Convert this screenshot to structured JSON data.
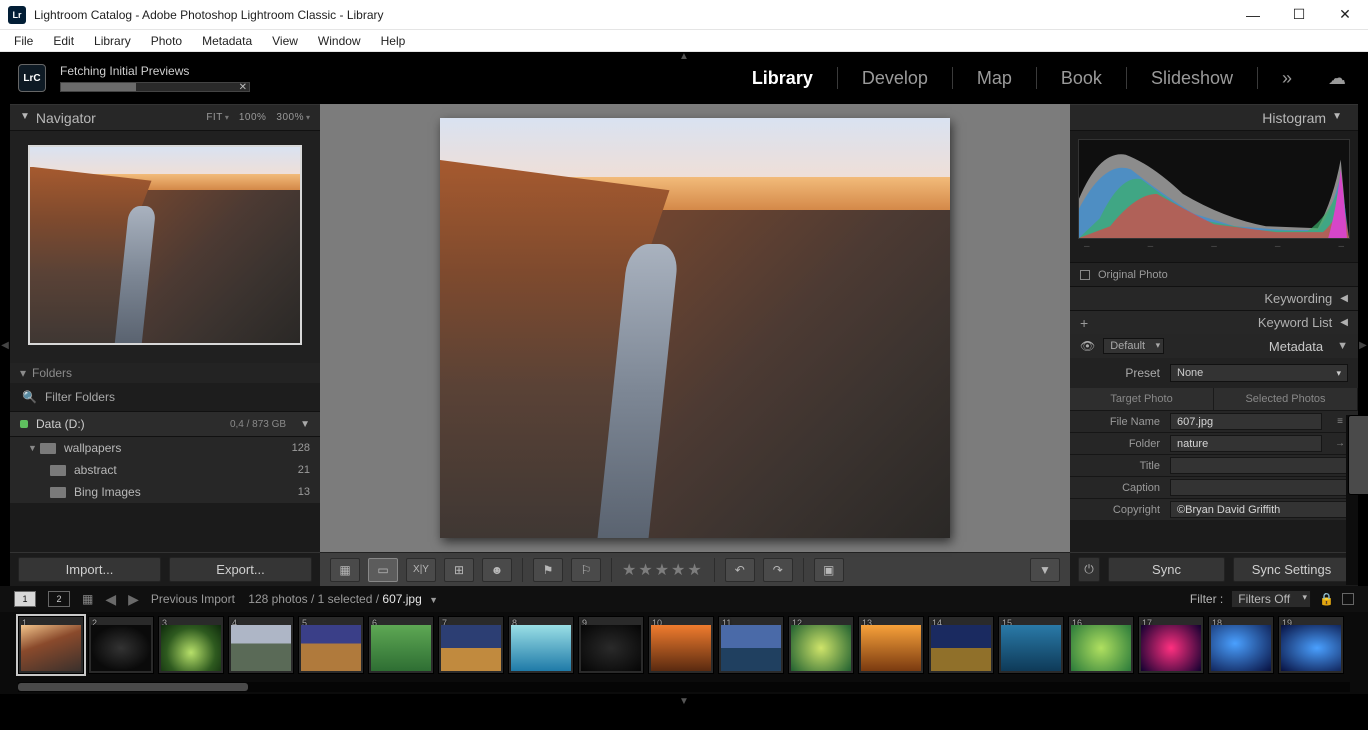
{
  "window": {
    "title": "Lightroom Catalog - Adobe Photoshop Lightroom Classic - Library",
    "app_badge": "Lr"
  },
  "menu": {
    "items": [
      "File",
      "Edit",
      "Library",
      "Photo",
      "Metadata",
      "View",
      "Window",
      "Help"
    ]
  },
  "topstrip": {
    "badge": "LrC",
    "status": "Fetching Initial Previews",
    "modules": [
      "Library",
      "Develop",
      "Map",
      "Book",
      "Slideshow"
    ],
    "active_module": "Library",
    "more_glyph": "»"
  },
  "navigator": {
    "title": "Navigator",
    "zoom_levels": [
      "FIT",
      "100%",
      "300%"
    ]
  },
  "folders": {
    "title": "Folders",
    "filter_placeholder": "Filter Folders",
    "drive": {
      "name": "Data (D:)",
      "size": "0,4 / 873 GB"
    },
    "tree": [
      {
        "name": "wallpapers",
        "count": 128,
        "expanded": true
      },
      {
        "name": "abstract",
        "count": 21,
        "child": true
      },
      {
        "name": "Bing Images",
        "count": 13,
        "child": true
      }
    ],
    "import_label": "Import...",
    "export_label": "Export..."
  },
  "right": {
    "histogram_title": "Histogram",
    "original_photo": "Original Photo",
    "keywording": "Keywording",
    "keyword_list": "Keyword List",
    "metadata_title": "Metadata",
    "metadata_default": "Default",
    "preset_label": "Preset",
    "preset_value": "None",
    "tabs": [
      "Target Photo",
      "Selected Photos"
    ],
    "rows": [
      {
        "label": "File Name",
        "value": "607.jpg",
        "icon": "≡"
      },
      {
        "label": "Folder",
        "value": "nature",
        "icon": "→"
      },
      {
        "label": "Title",
        "value": ""
      },
      {
        "label": "Caption",
        "value": ""
      },
      {
        "label": "Copyright",
        "value": "©Bryan David Griffith"
      }
    ],
    "sync": "Sync",
    "sync_settings": "Sync Settings"
  },
  "filmstrip": {
    "source": "Previous Import",
    "count_text": "128 photos / 1 selected /",
    "current": "607.jpg",
    "filter_label": "Filter :",
    "filter_value": "Filters Off",
    "screens": [
      "1",
      "2"
    ],
    "indices": [
      "1",
      "2",
      "3",
      "4",
      "5",
      "6",
      "7",
      "8",
      "9",
      "10",
      "11",
      "12",
      "13",
      "14",
      "15",
      "16",
      "17",
      "18",
      "19"
    ]
  }
}
